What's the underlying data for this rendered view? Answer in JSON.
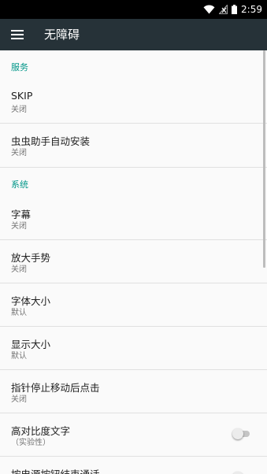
{
  "status_bar": {
    "time": "2:59",
    "icons": [
      "wifi-icon",
      "no-signal-icon",
      "battery-icon"
    ]
  },
  "app_bar": {
    "title": "无障碍",
    "menu_icon": "menu-icon"
  },
  "sections": {
    "services": {
      "header": "服务",
      "items": [
        {
          "title": "SKIP",
          "subtitle": "关闭"
        },
        {
          "title": "虫虫助手自动安装",
          "subtitle": "关闭"
        }
      ]
    },
    "system": {
      "header": "系统",
      "items": [
        {
          "title": "字幕",
          "subtitle": "关闭"
        },
        {
          "title": "放大手势",
          "subtitle": "关闭"
        },
        {
          "title": "字体大小",
          "subtitle": "默认"
        },
        {
          "title": "显示大小",
          "subtitle": "默认"
        },
        {
          "title": "指针停止移动后点击",
          "subtitle": "关闭"
        },
        {
          "title": "高对比度文字",
          "subtitle": "（实验性）",
          "toggle": false
        },
        {
          "title": "按电源按钮结束通话",
          "toggle": false
        }
      ]
    }
  },
  "colors": {
    "status_bar": "#000000",
    "app_bar": "#263238",
    "accent": "#009688",
    "background": "#fafafa"
  }
}
